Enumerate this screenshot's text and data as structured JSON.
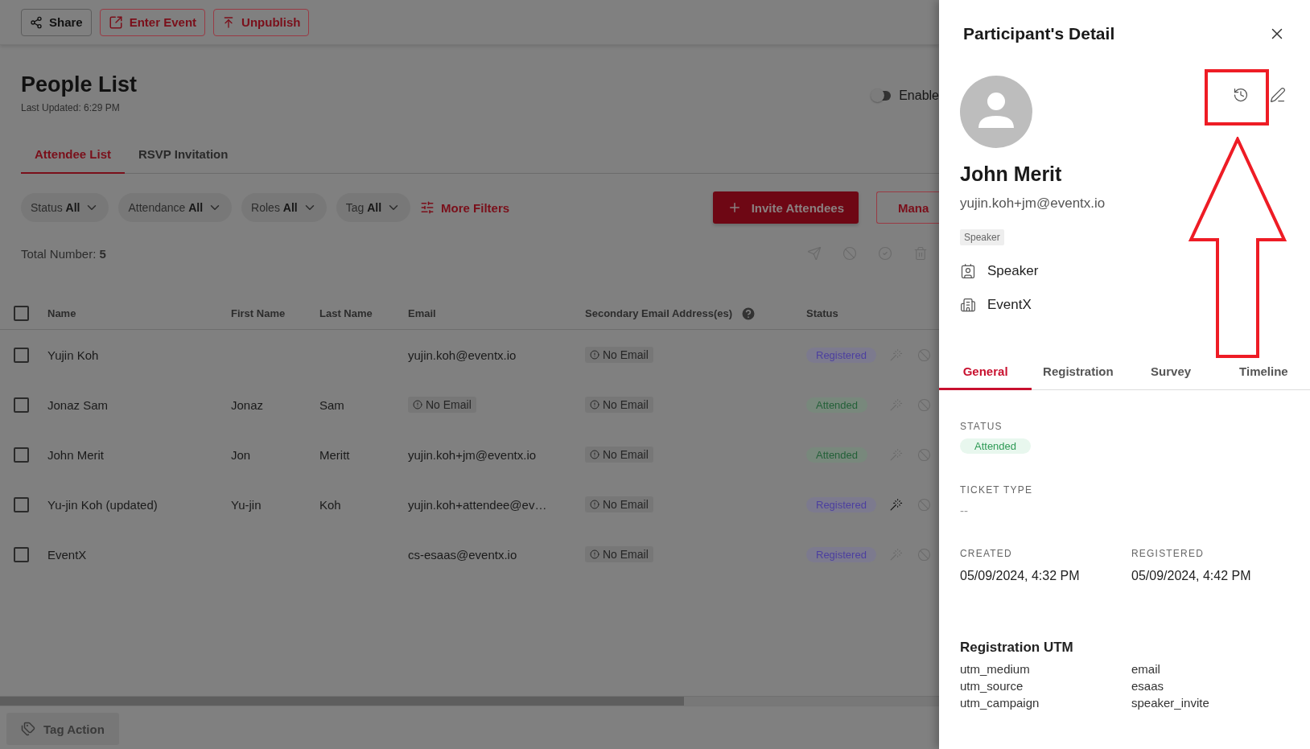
{
  "toolbar": {
    "buttons": [
      {
        "label": "Share",
        "kind": "neutral"
      },
      {
        "label": "Enter Event",
        "kind": "enter"
      },
      {
        "label": "Unpublish",
        "kind": "unpublish"
      }
    ]
  },
  "page": {
    "title": "People List",
    "last_updated": "Last Updated: 6:29 PM",
    "toggle": {
      "label": "Enable",
      "on": false
    }
  },
  "tabs": [
    {
      "label": "Attendee List",
      "selected": true
    },
    {
      "label": "RSVP Invitation",
      "selected": false
    }
  ],
  "filters": [
    {
      "label": "Status",
      "value": "All"
    },
    {
      "label": "Attendance",
      "value": "All"
    },
    {
      "label": "Roles",
      "value": "All"
    },
    {
      "label": "Tag",
      "value": "All"
    }
  ],
  "more_filters": "More Filters",
  "invite_button": "Invite Attendees",
  "manage_button": "Mana",
  "total": {
    "label": "Total Number:",
    "value": "5"
  },
  "table": {
    "all_checked": false,
    "columns": [
      "Name",
      "First Name",
      "Last Name",
      "Email",
      "Secondary Email Address(es)",
      "Status"
    ],
    "rows": [
      {
        "checked": false,
        "name": "Yujin Koh",
        "email": {
          "kind": "text",
          "text": "yujin.koh@eventx.io"
        },
        "secondary": "No Email",
        "status": {
          "kind": "registered",
          "label": "Registered"
        },
        "action_active": false
      },
      {
        "checked": false,
        "name": "Jonaz Sam",
        "first_name": "Jonaz",
        "last_name": "Sam",
        "email": {
          "kind": "missing",
          "text": "No Email"
        },
        "secondary": "No Email",
        "status": {
          "kind": "attended",
          "label": "Attended"
        },
        "action_active": false
      },
      {
        "checked": false,
        "name": "John Merit",
        "first_name": "Jon",
        "last_name": "Meritt",
        "email": {
          "kind": "text",
          "text": "yujin.koh+jm@eventx.io"
        },
        "secondary": "No Email",
        "status": {
          "kind": "attended",
          "label": "Attended"
        },
        "action_active": false
      },
      {
        "checked": false,
        "name": "Yu-jin Koh (updated)",
        "first_name": "Yu-jin",
        "last_name": "Koh",
        "email": {
          "kind": "text",
          "text": "yujin.koh+attendee@ev…"
        },
        "secondary": "No Email",
        "status": {
          "kind": "registered",
          "label": "Registered"
        },
        "action_active": true
      },
      {
        "checked": false,
        "name": "EventX",
        "email": {
          "kind": "text",
          "text": "cs-esaas@eventx.io"
        },
        "secondary": "No Email",
        "status": {
          "kind": "registered",
          "label": "Registered"
        },
        "action_active": false
      }
    ]
  },
  "tag_action": {
    "label": "Tag Action",
    "disabled": true
  },
  "drawer": {
    "title": "Participant's Detail",
    "name": "John Merit",
    "email": "yujin.koh+jm@eventx.io",
    "tag": "Speaker",
    "details": [
      {
        "kind": "role",
        "text": "Speaker"
      },
      {
        "kind": "company",
        "text": "EventX"
      }
    ],
    "tabs": [
      {
        "label": "General",
        "selected": true
      },
      {
        "label": "Registration",
        "selected": false
      },
      {
        "label": "Survey",
        "selected": false
      },
      {
        "label": "Timeline",
        "selected": false
      }
    ],
    "status_label": "STATUS",
    "status": {
      "kind": "attended",
      "label": "Attended"
    },
    "ticket_label": "TICKET TYPE",
    "ticket_value": "--",
    "created_label": "CREATED",
    "created": "05/09/2024, 4:32 PM",
    "registered_label": "REGISTERED",
    "registered": "05/09/2024, 4:42 PM",
    "utm_title": "Registration UTM",
    "utm": [
      {
        "key": "utm_medium",
        "value": "email"
      },
      {
        "key": "utm_source",
        "value": "esaas"
      },
      {
        "key": "utm_campaign",
        "value": "speaker_invite"
      }
    ]
  }
}
